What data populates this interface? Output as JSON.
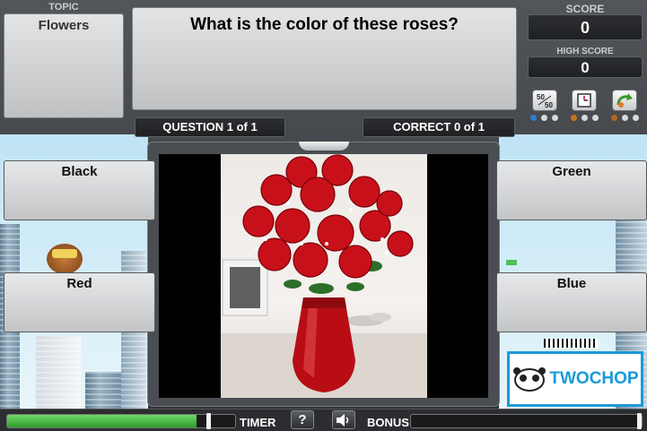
{
  "topic": {
    "label": "TOPIC",
    "value": "Flowers"
  },
  "question": {
    "text": "What is the color of these roses?"
  },
  "score": {
    "label": "SCORE",
    "value": "0",
    "high_label": "HIGH SCORE",
    "high_value": "0"
  },
  "progress": {
    "question": "QUESTION 1 of 1",
    "correct": "CORRECT 0 of 1"
  },
  "lifelines": {
    "fifty": "50/50",
    "fifty_top": "50",
    "fifty_bottom": "50"
  },
  "answers": {
    "a": "Black",
    "b": "Green",
    "c": "Red",
    "d": "Blue"
  },
  "bottom": {
    "timer_label": "TIMER",
    "help": "?",
    "bonus_label": "BONUS",
    "timer_fraction": 0.83
  },
  "brand": {
    "logo_text": "TWOCHOP"
  },
  "colors": {
    "timer": "#3fb53a",
    "logo": "#1a9ad8"
  }
}
